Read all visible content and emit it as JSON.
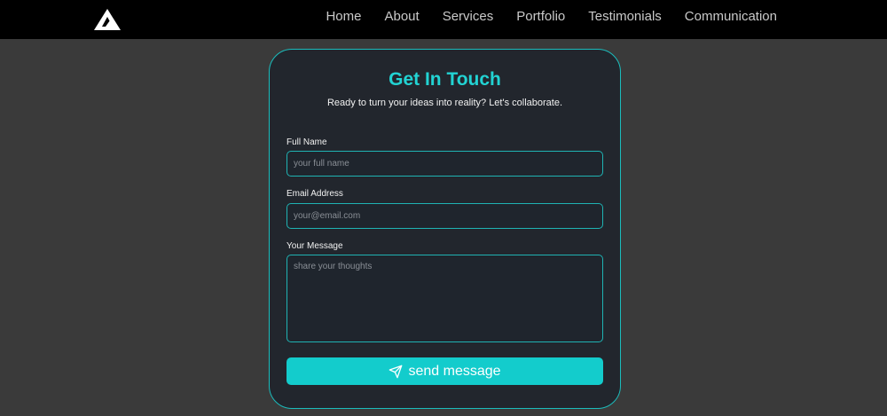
{
  "nav": {
    "logo_icon": "triangle-logo-icon",
    "links": [
      "Home",
      "About",
      "Services",
      "Portfolio",
      "Testimonials",
      "Communication"
    ]
  },
  "contact": {
    "title": "Get In Touch",
    "subtitle": "Ready to turn your ideas into reality? Let's collaborate.",
    "fields": {
      "name_label": "Full Name",
      "name_placeholder": "your full name",
      "email_label": "Email Address",
      "email_placeholder": "your@email.com",
      "message_label": "Your Message",
      "message_placeholder": "share your thoughts"
    },
    "submit_label": "send message",
    "submit_icon": "paper-plane-icon"
  },
  "colors": {
    "accent": "#13cccc",
    "title": "#22d3d3",
    "page_bg": "#3a3a3a",
    "card_bg": "#22262d",
    "nav_bg": "#000000"
  }
}
